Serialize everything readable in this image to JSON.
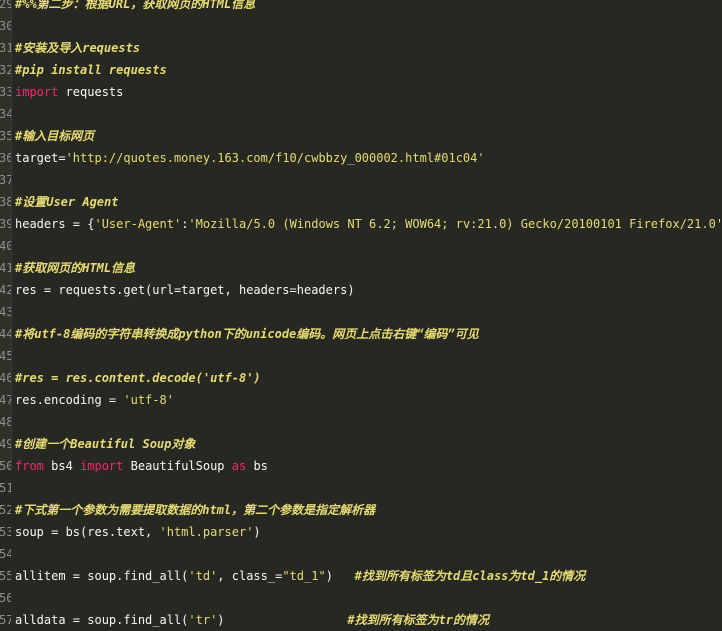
{
  "lines": [
    {
      "n": "29",
      "tokens": [
        {
          "t": "cmt",
          "v": "#%%第二步：根据URL，获取网页的HTML信息"
        }
      ]
    },
    {
      "n": "30",
      "tokens": []
    },
    {
      "n": "31",
      "tokens": [
        {
          "t": "cmt",
          "v": "#安装及导入requests"
        }
      ]
    },
    {
      "n": "32",
      "tokens": [
        {
          "t": "cmt",
          "v": "#pip install requests"
        }
      ]
    },
    {
      "n": "33",
      "tokens": [
        {
          "t": "kw",
          "v": "import"
        },
        {
          "t": "txt",
          "v": " requests"
        }
      ]
    },
    {
      "n": "34",
      "tokens": []
    },
    {
      "n": "35",
      "tokens": [
        {
          "t": "cmt",
          "v": "#输入目标网页"
        }
      ]
    },
    {
      "n": "36",
      "tokens": [
        {
          "t": "txt",
          "v": "target="
        },
        {
          "t": "str",
          "v": "'http://quotes.money.163.com/f10/cwbbzy_000002.html#01c04'"
        }
      ]
    },
    {
      "n": "37",
      "tokens": []
    },
    {
      "n": "38",
      "tokens": [
        {
          "t": "cmt",
          "v": "#设置User Agent"
        }
      ]
    },
    {
      "n": "39",
      "tokens": [
        {
          "t": "txt",
          "v": "headers = {"
        },
        {
          "t": "str",
          "v": "'User-Agent'"
        },
        {
          "t": "txt",
          "v": ":"
        },
        {
          "t": "str",
          "v": "'Mozilla/5.0 (Windows NT 6.2; WOW64; rv:21.0) Gecko/20100101 Firefox/21.0'"
        },
        {
          "t": "txt",
          "v": "}"
        }
      ]
    },
    {
      "n": "40",
      "tokens": []
    },
    {
      "n": "41",
      "tokens": [
        {
          "t": "cmt",
          "v": "#获取网页的HTML信息"
        }
      ]
    },
    {
      "n": "42",
      "tokens": [
        {
          "t": "txt",
          "v": "res = requests.get(url=target, headers=headers)"
        }
      ]
    },
    {
      "n": "43",
      "tokens": []
    },
    {
      "n": "44",
      "tokens": [
        {
          "t": "cmt",
          "v": "#将utf-8编码的字符串转换成python下的unicode编码。网页上点击右键“编码”可见"
        }
      ]
    },
    {
      "n": "45",
      "tokens": []
    },
    {
      "n": "46",
      "tokens": [
        {
          "t": "cmt",
          "v": "#res = res.content.decode('utf-8')"
        }
      ]
    },
    {
      "n": "47",
      "tokens": [
        {
          "t": "txt",
          "v": "res.encoding = "
        },
        {
          "t": "str",
          "v": "'utf-8'"
        }
      ]
    },
    {
      "n": "48",
      "tokens": []
    },
    {
      "n": "49",
      "tokens": [
        {
          "t": "cmt",
          "v": "#创建一个Beautiful Soup对象"
        }
      ]
    },
    {
      "n": "50",
      "tokens": [
        {
          "t": "kw",
          "v": "from"
        },
        {
          "t": "txt",
          "v": " bs4 "
        },
        {
          "t": "kw",
          "v": "import"
        },
        {
          "t": "txt",
          "v": " BeautifulSoup "
        },
        {
          "t": "kw",
          "v": "as"
        },
        {
          "t": "txt",
          "v": " bs"
        }
      ]
    },
    {
      "n": "51",
      "tokens": []
    },
    {
      "n": "52",
      "tokens": [
        {
          "t": "cmt",
          "v": "#下式第一个参数为需要提取数据的html，第二个参数是指定解析器"
        }
      ]
    },
    {
      "n": "53",
      "tokens": [
        {
          "t": "txt",
          "v": "soup = bs(res.text, "
        },
        {
          "t": "str",
          "v": "'html.parser'"
        },
        {
          "t": "txt",
          "v": ")"
        }
      ]
    },
    {
      "n": "54",
      "tokens": []
    },
    {
      "n": "55",
      "tokens": [
        {
          "t": "txt",
          "v": "allitem = soup.find_all("
        },
        {
          "t": "str",
          "v": "'td'"
        },
        {
          "t": "txt",
          "v": ", class_="
        },
        {
          "t": "str",
          "v": "\"td_1\""
        },
        {
          "t": "txt",
          "v": ")   "
        },
        {
          "t": "cmt",
          "v": "#找到所有标签为td且class为td_1的情况"
        }
      ]
    },
    {
      "n": "56",
      "tokens": []
    },
    {
      "n": "57",
      "tokens": [
        {
          "t": "txt",
          "v": "alldata = soup.find_all("
        },
        {
          "t": "str",
          "v": "'tr'"
        },
        {
          "t": "txt",
          "v": ")                 "
        },
        {
          "t": "cmt",
          "v": "#找到所有标签为tr的情况"
        }
      ]
    }
  ]
}
